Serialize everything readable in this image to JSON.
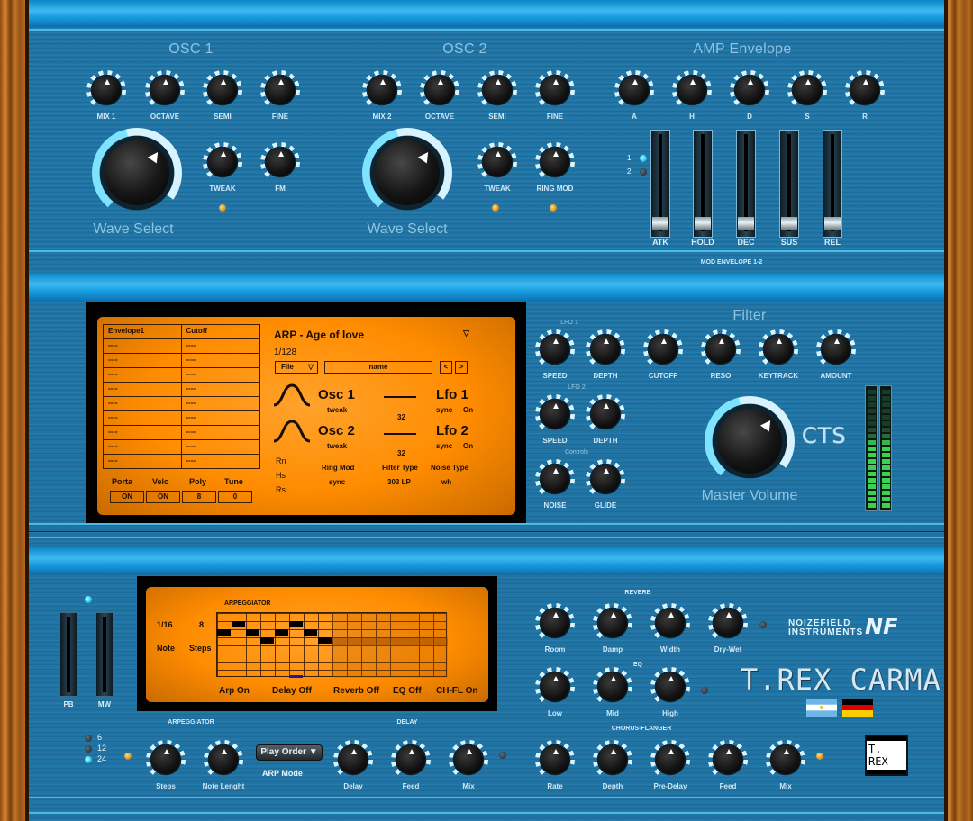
{
  "osc1": {
    "title": "OSC 1",
    "knobs": [
      "MIX 1",
      "OCTAVE",
      "SEMI",
      "FINE"
    ],
    "small_knobs": [
      "TWEAK",
      "FM"
    ],
    "wave_label": "Wave Select"
  },
  "osc2": {
    "title": "OSC 2",
    "knobs": [
      "MIX 2",
      "OCTAVE",
      "SEMI",
      "FINE"
    ],
    "small_knobs": [
      "TWEAK",
      "RING MOD"
    ],
    "wave_label": "Wave Select"
  },
  "amp": {
    "title": "AMP Envelope",
    "knobs": [
      "A",
      "H",
      "D",
      "S",
      "R"
    ],
    "mod_sel": [
      "1",
      "2"
    ],
    "faders": [
      "ATK",
      "HOLD",
      "DEC",
      "SUS",
      "REL"
    ],
    "mod_label": "MOD  ENVELOPE 1-2"
  },
  "mod_table": {
    "headers": [
      "Envelope1",
      "Cutoff"
    ],
    "rows": [
      "----",
      "----",
      "----",
      "----",
      "----",
      "----",
      "----",
      "----",
      "----"
    ],
    "params": [
      "Porta",
      "Velo",
      "Poly",
      "Tune"
    ],
    "values": [
      "ON",
      "ON",
      "8",
      "0"
    ]
  },
  "preset": {
    "name": "ARP - Age of love",
    "page": "1/128",
    "file_label": "File",
    "name_field": "name",
    "prev": "<",
    "next": ">",
    "arrow": "▽"
  },
  "lcd_osc": {
    "osc1": "Osc 1",
    "osc2": "Osc 2",
    "tweak": "tweak",
    "lfo1": "Lfo 1",
    "lfo2": "Lfo 2",
    "sync": "sync",
    "on": "On",
    "val1": "32",
    "val2": "32",
    "side": [
      "Rn",
      "Hs",
      "Rs"
    ],
    "ring_mod_label": "Ring Mod",
    "ring_mod_val": "sync",
    "filter_type_label": "Filter Type",
    "filter_type_val": "303 LP",
    "noise_type_label": "Noise Type",
    "noise_type_val": "wh"
  },
  "filter": {
    "title": "Filter",
    "lfo1_label": "LFO 1",
    "lfo2_label": "LFO 2",
    "controls_label": "Controls",
    "lfo1_knobs": [
      "SPEED",
      "DEPTH"
    ],
    "main_knobs": [
      "CUTOFF",
      "RESO",
      "KEYTRACK",
      "AMOUNT"
    ],
    "lfo2_knobs": [
      "SPEED",
      "DEPTH"
    ],
    "ctrl_knobs": [
      "NOISE",
      "GLIDE"
    ],
    "master_label": "Master Volume",
    "cts_logo": "CTS"
  },
  "arp_lcd": {
    "title": "ARPEGGIATOR",
    "rate": "1/16",
    "steps": "8",
    "note_label": "Note",
    "steps_label": "Steps",
    "steps_pattern": [
      3,
      4,
      3,
      2,
      3,
      4,
      3,
      2
    ],
    "buttons": [
      "Arp On",
      "Delay Off",
      "Reverb Off",
      "EQ Off",
      "CH-FL On"
    ]
  },
  "pitch": {
    "pb": "PB",
    "mw": "MW"
  },
  "reverb": {
    "title": "REVERB",
    "knobs": [
      "Room",
      "Damp",
      "Width",
      "Dry-Wet"
    ]
  },
  "eq": {
    "title": "EQ",
    "knobs": [
      "Low",
      "Mid",
      "High"
    ]
  },
  "brand": {
    "line1": "NOIZEFIELD",
    "line2": "INSTRUMENTS",
    "mark": "NF",
    "product": "T.REX CARMA",
    "badge": "T. REX"
  },
  "arp_section": {
    "title": "ARPEGGIATOR",
    "options": [
      "6",
      "12",
      "24"
    ],
    "knobs": [
      "Steps",
      "Note Lenght"
    ],
    "play_order": "Play Order ▼",
    "mode_label": "ARP Mode"
  },
  "delay": {
    "title": "DELAY",
    "knobs": [
      "Delay",
      "Feed",
      "Mix"
    ]
  },
  "chorus": {
    "title": "CHORUS-FLANGER",
    "knobs": [
      "Rate",
      "Depth",
      "Pre-Delay",
      "Feed",
      "Mix"
    ]
  }
}
